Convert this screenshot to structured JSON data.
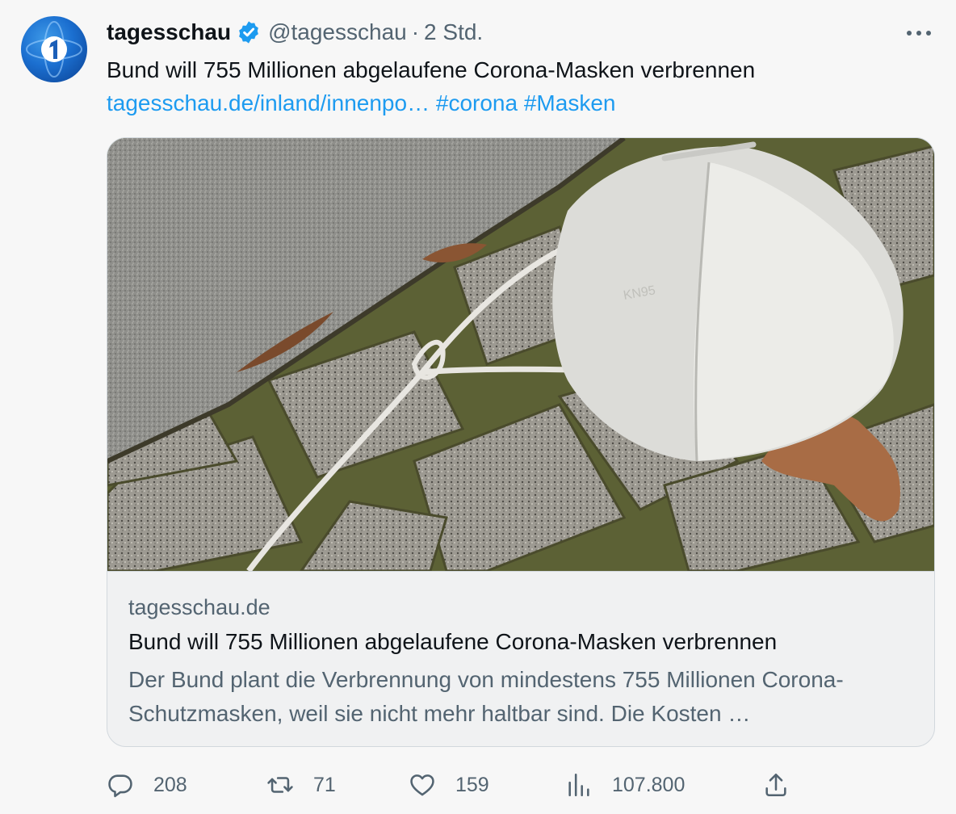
{
  "tweet": {
    "author_name": "tagesschau",
    "handle": "@tagesschau",
    "separator": "·",
    "time": "2 Std.",
    "text": "Bund will 755 Millionen abgelaufene Corona-Masken verbrennen",
    "link_text": "tagesschau.de/inland/innenpo…",
    "hashtags": [
      "#corona",
      "#Masken"
    ]
  },
  "card": {
    "domain": "tagesschau.de",
    "title": "Bund will 755 Millionen abgelaufene Corona-Masken verbrennen",
    "description": "Der Bund plant die Verbrennung von mindestens 755 Millionen Corona-Schutzmasken, weil sie nicht mehr haltbar sind. Die Kosten …",
    "image_mask_print": "KN95"
  },
  "actions": {
    "replies": "208",
    "retweets": "71",
    "likes": "159",
    "views": "107.800"
  },
  "icons": {
    "verified": "verified-badge-icon",
    "more": "more-icon",
    "reply": "reply-icon",
    "retweet": "retweet-icon",
    "like": "heart-icon",
    "views": "views-icon",
    "share": "share-icon"
  },
  "colors": {
    "link": "#1d9bf0",
    "secondary_text": "#536471",
    "primary_text": "#0f1419",
    "background": "#f7f7f7"
  }
}
